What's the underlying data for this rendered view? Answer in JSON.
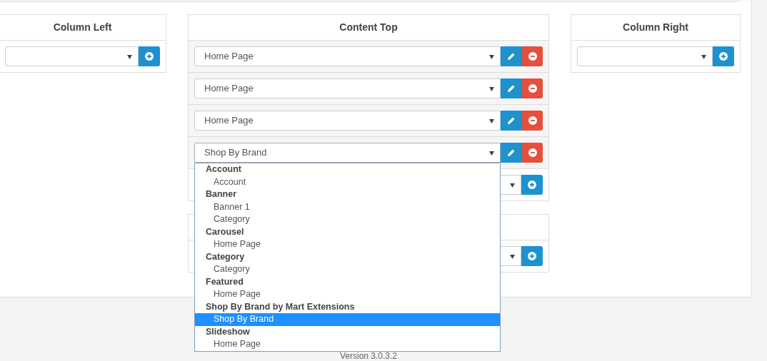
{
  "columns": [
    {
      "title": "Column Left",
      "rows": [
        {
          "kind": "add",
          "value": ""
        }
      ]
    },
    {
      "title": "Content Top",
      "rows": [
        {
          "kind": "module",
          "value": "Home Page"
        },
        {
          "kind": "module",
          "value": "Home Page"
        },
        {
          "kind": "module",
          "value": "Home Page"
        },
        {
          "kind": "module",
          "value": "Shop By Brand",
          "open": true
        },
        {
          "kind": "add",
          "value": ""
        }
      ]
    },
    {
      "title": "Column Right",
      "rows": [
        {
          "kind": "add",
          "value": ""
        }
      ]
    }
  ],
  "lower_panel": {
    "rows": [
      {
        "kind": "add",
        "value": ""
      }
    ]
  },
  "dropdown": {
    "groups": [
      {
        "label": "Account",
        "options": [
          {
            "label": "Account",
            "selected": false
          }
        ]
      },
      {
        "label": "Banner",
        "options": [
          {
            "label": "Banner 1",
            "selected": false
          },
          {
            "label": "Category",
            "selected": false
          }
        ]
      },
      {
        "label": "Carousel",
        "options": [
          {
            "label": "Home Page",
            "selected": false
          }
        ]
      },
      {
        "label": "Category",
        "options": [
          {
            "label": "Category",
            "selected": false
          }
        ]
      },
      {
        "label": "Featured",
        "options": [
          {
            "label": "Home Page",
            "selected": false
          }
        ]
      },
      {
        "label": "Shop By Brand by Mart Extensions",
        "options": [
          {
            "label": "Shop By Brand",
            "selected": true
          }
        ]
      },
      {
        "label": "Slideshow",
        "options": [
          {
            "label": "Home Page",
            "selected": false
          }
        ]
      }
    ]
  },
  "footer": {
    "version": "Version 3.0.3.2"
  }
}
